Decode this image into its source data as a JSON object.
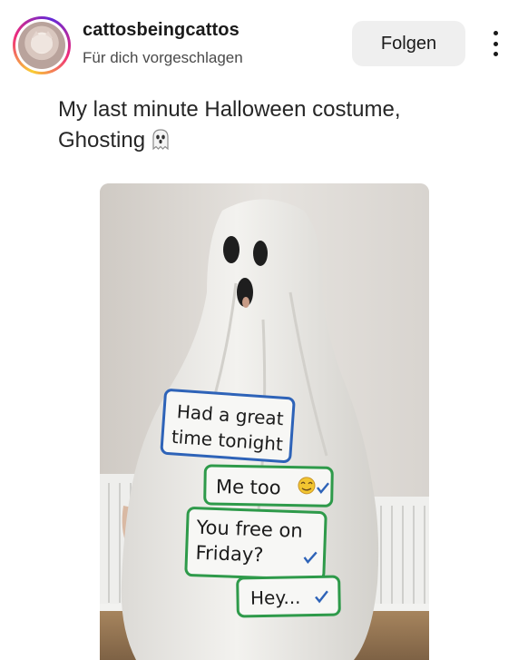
{
  "post": {
    "username": "cattosbeingcattos",
    "subtitle": "Für dich vorgeschlagen",
    "follow_label": "Folgen",
    "caption": "My last minute Halloween costume, Ghosting",
    "caption_emoji": "ghost-emoji"
  },
  "photo": {
    "messages": [
      {
        "line1": "Had a great",
        "line2": "time tonight",
        "border": "#2e63b8"
      },
      {
        "line1": "Me too",
        "line2": "",
        "border": "#2e9a4a"
      },
      {
        "line1": "You free on",
        "line2": "Friday?",
        "border": "#2e9a4a"
      },
      {
        "line1": "Hey...",
        "line2": "",
        "border": "#2e9a4a"
      }
    ]
  },
  "colors": {
    "follow_bg": "#efefef",
    "ring_start": "#f9ce34",
    "ring_mid": "#ee2a7b",
    "ring_end": "#6228d7"
  }
}
